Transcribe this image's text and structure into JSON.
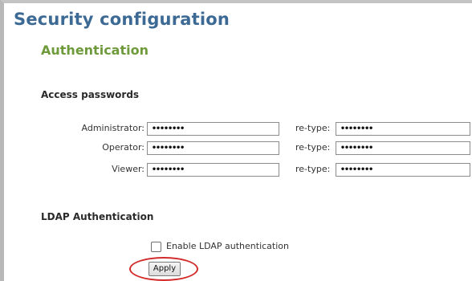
{
  "page": {
    "title": "Security configuration"
  },
  "section": {
    "title": "Authentication"
  },
  "access_passwords": {
    "heading": "Access passwords",
    "retype_label": "re-type:",
    "rows": [
      {
        "label": "Administrator:",
        "value": "••••••••",
        "retype_value": "••••••••"
      },
      {
        "label": "Operator:",
        "value": "••••••••",
        "retype_value": "••••••••"
      },
      {
        "label": "Viewer:",
        "value": "••••••••",
        "retype_value": "••••••••"
      }
    ]
  },
  "ldap": {
    "heading": "LDAP Authentication",
    "checkbox_label": "Enable LDAP authentication",
    "checked": false
  },
  "actions": {
    "apply_label": "Apply"
  },
  "colors": {
    "title": "#3d6a94",
    "section_title": "#6f9a3c",
    "highlight_ring": "#d32b2b"
  }
}
